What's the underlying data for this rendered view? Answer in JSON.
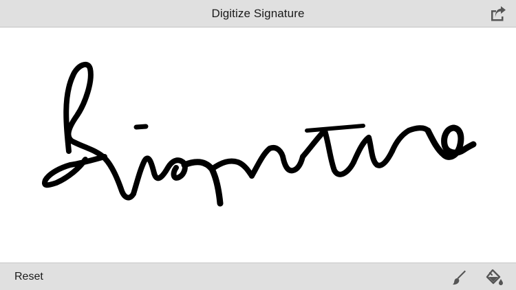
{
  "header": {
    "title": "Digitize Signature"
  },
  "icons": {
    "share": "share-icon",
    "brush": "brush-icon",
    "bucket": "paint-bucket-icon"
  },
  "footer": {
    "reset_label": "Reset"
  },
  "canvas": {
    "ink_color": "#000000",
    "background_color": "#ffffff"
  },
  "colors": {
    "bar_background": "#e0e0e0",
    "icon_color": "#555555"
  }
}
